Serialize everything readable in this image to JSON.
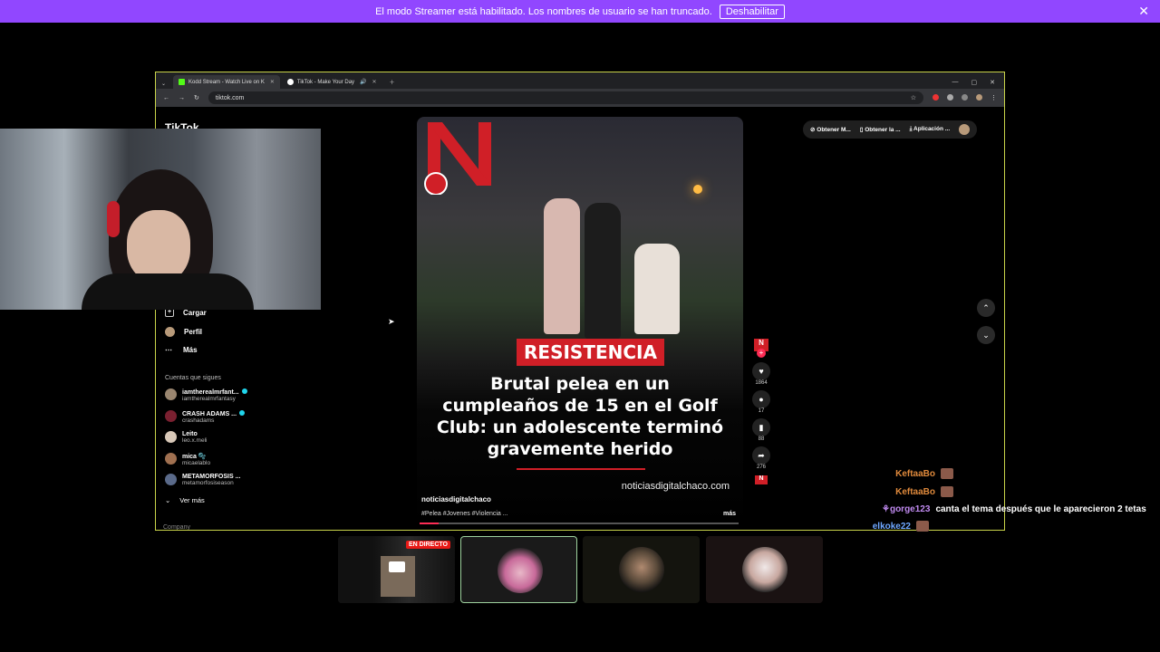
{
  "banner": {
    "message": "El modo Streamer está habilitado. Los nombres de usuario se han truncado.",
    "button": "Deshabilitar",
    "close": "✕"
  },
  "browser": {
    "tabs": [
      {
        "label": "Kodd Stream - Watch Live on K",
        "favicon_color": "#53fc18"
      },
      {
        "label": "TikTok - Make Your Day",
        "favicon_color": "#ffffff"
      }
    ],
    "url": "tiktok.com"
  },
  "tiktok": {
    "logo": "TikTok",
    "nav": [
      {
        "label": "Cargar",
        "icon": "plus-icon"
      },
      {
        "label": "Perfil",
        "icon": "profile-icon"
      },
      {
        "label": "Más",
        "icon": "more-icon"
      }
    ],
    "following_header": "Cuentas que sigues",
    "following": [
      {
        "name": "iamtherealmrfant...",
        "handle": "iamtherealmrfantasy",
        "verified": true
      },
      {
        "name": "CRASH ADAMS ...",
        "handle": "crashadams",
        "verified": true
      },
      {
        "name": "Leito",
        "handle": "leo.x.meli",
        "verified": false
      },
      {
        "name": "mica 🫧",
        "handle": "micaelablo",
        "verified": false
      },
      {
        "name": "METAMORFOSIS ...",
        "handle": "metamorfosiseason",
        "verified": false
      }
    ],
    "see_more": "Ver más",
    "company": "Company",
    "top_buttons": [
      "Obtener M...",
      "Obtener la ...",
      "Aplicación ..."
    ],
    "video": {
      "tag": "RESISTENCIA",
      "headline": "Brutal pelea en un cumpleaños de 15 en el Golf Club: un adolescente terminó gravemente herido",
      "site": "noticiasdigitalchaco.com",
      "author": "noticiasdigitalchaco",
      "hashtags": "#Pelea #Jovenes #Violencia ...",
      "more": "más",
      "progress": 0.06
    },
    "actions": [
      {
        "icon": "heart-icon",
        "count": "1864"
      },
      {
        "icon": "comment-icon",
        "count": "17"
      },
      {
        "icon": "bookmark-icon",
        "count": "88"
      },
      {
        "icon": "share-icon",
        "count": "276"
      }
    ]
  },
  "chat": [
    {
      "user": "KeftaaBo",
      "color": "#e08a3c",
      "text": ""
    },
    {
      "user": "KeftaaBo",
      "color": "#e08a3c",
      "text": ""
    },
    {
      "user": "gorge123",
      "color": "#c08af0",
      "text": "canta el tema después que le aparecieron 2 tetas"
    },
    {
      "user": "elkoke22",
      "color": "#6fa8ff",
      "text": ""
    }
  ],
  "thumbs": {
    "live_badge": "EN DIRECTO"
  }
}
